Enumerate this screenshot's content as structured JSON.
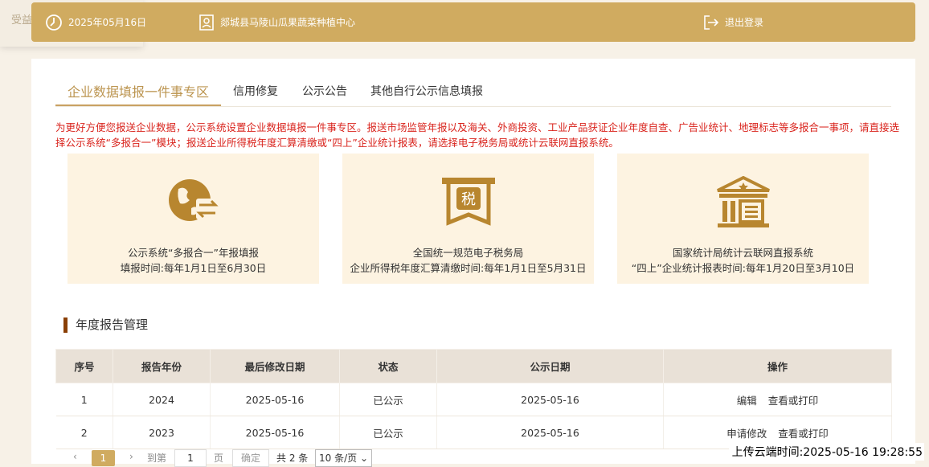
{
  "behind_tab": {
    "label": "受益"
  },
  "header": {
    "date": "2025年05月16日",
    "org": "郯城县马陵山瓜果蔬菜种植中心",
    "logout": "退出登录"
  },
  "tabs": [
    {
      "label": "企业数据填报一件事专区",
      "active": true
    },
    {
      "label": "信用修复"
    },
    {
      "label": "公示公告"
    },
    {
      "label": "其他自行公示信息填报"
    }
  ],
  "notice": "为更好方便您报送企业数据，公示系统设置企业数据填报一件事专区。报送市场监管年报以及海关、外商投资、工业产品获证企业年度自查、广告业统计、地理标志等多报合一事项，请直接选择公示系统“多报合一”模块；报送企业所得税年度汇算清缴或“四上”企业统计报表，请选择电子税务局或统计云联网直报系统。",
  "cards": [
    {
      "title": "公示系统“多报合一”年报填报",
      "time": "填报时间:每年1月1日至6月30日",
      "icon": "globe-exchange-icon"
    },
    {
      "title": "全国统一规范电子税务局",
      "time": "企业所得税年度汇算清缴时间:每年1月1日至5月31日",
      "icon": "tax-icon",
      "icon_text": "税"
    },
    {
      "title": "国家统计局统计云联网直报系统",
      "time": "“四上”企业统计报表时间:每年1月20日至3月10日",
      "icon": "government-building-icon"
    }
  ],
  "section_title": "年度报告管理",
  "table": {
    "headers": [
      "序号",
      "报告年份",
      "最后修改日期",
      "状态",
      "公示日期",
      "操作"
    ],
    "rows": [
      {
        "no": "1",
        "year": "2024",
        "modified": "2025-05-16",
        "status": "已公示",
        "published": "2025-05-16",
        "ops": [
          "编辑",
          "查看或打印"
        ]
      },
      {
        "no": "2",
        "year": "2023",
        "modified": "2025-05-16",
        "status": "已公示",
        "published": "2025-05-16",
        "ops": [
          "申请修改",
          "查看或打印"
        ]
      }
    ]
  },
  "pagination": {
    "prev": "‹",
    "current": "1",
    "next": "›",
    "goto_label": "到第",
    "page_input": "1",
    "page_unit": "页",
    "confirm": "确定",
    "total": "共 2 条",
    "page_size": "10 条/页"
  },
  "upload_time": "上传云端时间:2025-05-16 19:28:55",
  "colors": {
    "gold": "#d0ab60",
    "icon_brown": "#b8862f",
    "notice_red": "#d9231c",
    "card_bg": "#fdf3e1",
    "section_bar": "#8a3f06"
  }
}
